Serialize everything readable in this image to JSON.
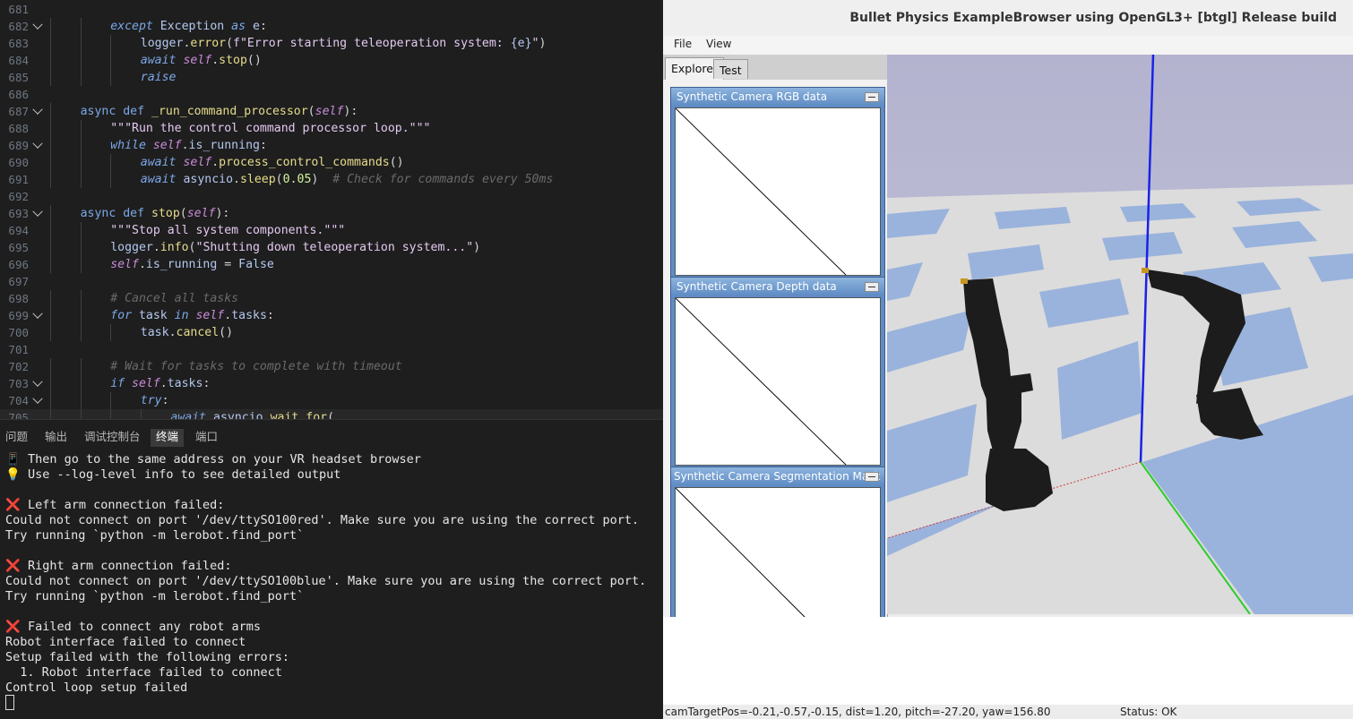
{
  "editor": {
    "lines": [
      {
        "num": "681",
        "indent": 0,
        "fold": false,
        "tokens": []
      },
      {
        "num": "682",
        "indent": 2,
        "fold": true,
        "tokens": [
          [
            "except ",
            "t-ctl"
          ],
          [
            "Exception ",
            "t-id"
          ],
          [
            "as ",
            "t-ctl"
          ],
          [
            "e",
            "t-id"
          ],
          [
            ":",
            "t-op"
          ]
        ]
      },
      {
        "num": "683",
        "indent": 3,
        "fold": false,
        "tokens": [
          [
            "logger",
            "t-id"
          ],
          [
            ".",
            "t-op"
          ],
          [
            "error",
            "t-fn"
          ],
          [
            "(",
            "t-op"
          ],
          [
            "f\"Error starting teleoperation system: ",
            "t-str"
          ],
          [
            "{e}",
            "t-id"
          ],
          [
            "\"",
            "t-str"
          ],
          [
            ")",
            "t-op"
          ]
        ]
      },
      {
        "num": "684",
        "indent": 3,
        "fold": false,
        "tokens": [
          [
            "await ",
            "t-ctl"
          ],
          [
            "self",
            "t-self"
          ],
          [
            ".",
            "t-op"
          ],
          [
            "stop",
            "t-fn"
          ],
          [
            "()",
            "t-op"
          ]
        ]
      },
      {
        "num": "685",
        "indent": 3,
        "fold": false,
        "tokens": [
          [
            "raise",
            "t-ctl"
          ]
        ]
      },
      {
        "num": "686",
        "indent": 0,
        "fold": false,
        "tokens": []
      },
      {
        "num": "687",
        "indent": 1,
        "fold": true,
        "tokens": [
          [
            "async ",
            "t-kw"
          ],
          [
            "def ",
            "t-kw"
          ],
          [
            "_run_command_processor",
            "t-fn"
          ],
          [
            "(",
            "t-op"
          ],
          [
            "self",
            "t-self"
          ],
          [
            "):",
            "t-op"
          ]
        ]
      },
      {
        "num": "688",
        "indent": 2,
        "fold": false,
        "tokens": [
          [
            "\"\"\"Run the control command processor loop.\"\"\"",
            "t-str"
          ]
        ]
      },
      {
        "num": "689",
        "indent": 2,
        "fold": true,
        "tokens": [
          [
            "while ",
            "t-ctl"
          ],
          [
            "self",
            "t-self"
          ],
          [
            ".",
            "t-op"
          ],
          [
            "is_running",
            "t-id"
          ],
          [
            ":",
            "t-op"
          ]
        ]
      },
      {
        "num": "690",
        "indent": 3,
        "fold": false,
        "tokens": [
          [
            "await ",
            "t-ctl"
          ],
          [
            "self",
            "t-self"
          ],
          [
            ".",
            "t-op"
          ],
          [
            "process_control_commands",
            "t-fn"
          ],
          [
            "()",
            "t-op"
          ]
        ]
      },
      {
        "num": "691",
        "indent": 3,
        "fold": false,
        "tokens": [
          [
            "await ",
            "t-ctl"
          ],
          [
            "asyncio",
            "t-id"
          ],
          [
            ".",
            "t-op"
          ],
          [
            "sleep",
            "t-fn"
          ],
          [
            "(",
            "t-op"
          ],
          [
            "0.05",
            "t-num"
          ],
          [
            ")  ",
            "t-op"
          ],
          [
            "# Check for commands every 50ms",
            "t-cm"
          ]
        ]
      },
      {
        "num": "692",
        "indent": 0,
        "fold": false,
        "tokens": []
      },
      {
        "num": "693",
        "indent": 1,
        "fold": true,
        "tokens": [
          [
            "async ",
            "t-kw"
          ],
          [
            "def ",
            "t-kw"
          ],
          [
            "stop",
            "t-fn"
          ],
          [
            "(",
            "t-op"
          ],
          [
            "self",
            "t-self"
          ],
          [
            "):",
            "t-op"
          ]
        ]
      },
      {
        "num": "694",
        "indent": 2,
        "fold": false,
        "tokens": [
          [
            "\"\"\"Stop all system components.\"\"\"",
            "t-str"
          ]
        ]
      },
      {
        "num": "695",
        "indent": 2,
        "fold": false,
        "tokens": [
          [
            "logger",
            "t-id"
          ],
          [
            ".",
            "t-op"
          ],
          [
            "info",
            "t-fn"
          ],
          [
            "(",
            "t-op"
          ],
          [
            "\"Shutting down teleoperation system...\"",
            "t-str"
          ],
          [
            ")",
            "t-op"
          ]
        ]
      },
      {
        "num": "696",
        "indent": 2,
        "fold": false,
        "tokens": [
          [
            "self",
            "t-self"
          ],
          [
            ".",
            "t-op"
          ],
          [
            "is_running ",
            "t-id"
          ],
          [
            "= ",
            "t-op"
          ],
          [
            "False",
            "t-id"
          ]
        ]
      },
      {
        "num": "697",
        "indent": 0,
        "fold": false,
        "tokens": []
      },
      {
        "num": "698",
        "indent": 2,
        "fold": false,
        "tokens": [
          [
            "# Cancel all tasks",
            "t-cm"
          ]
        ]
      },
      {
        "num": "699",
        "indent": 2,
        "fold": true,
        "tokens": [
          [
            "for ",
            "t-ctl"
          ],
          [
            "task ",
            "t-id"
          ],
          [
            "in ",
            "t-ctl"
          ],
          [
            "self",
            "t-self"
          ],
          [
            ".",
            "t-op"
          ],
          [
            "tasks",
            "t-id"
          ],
          [
            ":",
            "t-op"
          ]
        ]
      },
      {
        "num": "700",
        "indent": 3,
        "fold": false,
        "tokens": [
          [
            "task",
            "t-id"
          ],
          [
            ".",
            "t-op"
          ],
          [
            "cancel",
            "t-fn"
          ],
          [
            "()",
            "t-op"
          ]
        ]
      },
      {
        "num": "701",
        "indent": 0,
        "fold": false,
        "tokens": []
      },
      {
        "num": "702",
        "indent": 2,
        "fold": false,
        "tokens": [
          [
            "# Wait for tasks to complete with timeout",
            "t-cm"
          ]
        ]
      },
      {
        "num": "703",
        "indent": 2,
        "fold": true,
        "tokens": [
          [
            "if ",
            "t-ctl"
          ],
          [
            "self",
            "t-self"
          ],
          [
            ".",
            "t-op"
          ],
          [
            "tasks",
            "t-id"
          ],
          [
            ":",
            "t-op"
          ]
        ]
      },
      {
        "num": "704",
        "indent": 3,
        "fold": true,
        "tokens": [
          [
            "try",
            "t-ctl"
          ],
          [
            ":",
            "t-op"
          ]
        ]
      },
      {
        "num": "705",
        "indent": 4,
        "fold": false,
        "tokens": [
          [
            "await ",
            "t-ctl"
          ],
          [
            "asyncio",
            "t-id"
          ],
          [
            ".",
            "t-op"
          ],
          [
            "wait_for",
            "t-fn"
          ],
          [
            "(",
            "t-op"
          ]
        ]
      }
    ]
  },
  "panel": {
    "tabs": [
      "问题",
      "输出",
      "调试控制台",
      "终端",
      "端口"
    ],
    "active_tab": "终端"
  },
  "terminal": {
    "lines": [
      {
        "icon": "📱",
        "text": " Then go to the same address on your VR headset browser"
      },
      {
        "icon": "💡",
        "text": " Use --log-level info to see detailed output"
      },
      {
        "icon": "",
        "text": ""
      },
      {
        "icon": "❌",
        "text": " Left arm connection failed:"
      },
      {
        "icon": "",
        "text": "Could not connect on port '/dev/ttySO100red'. Make sure you are using the correct port."
      },
      {
        "icon": "",
        "text": "Try running `python -m lerobot.find_port`"
      },
      {
        "icon": "",
        "text": ""
      },
      {
        "icon": "❌",
        "text": " Right arm connection failed:"
      },
      {
        "icon": "",
        "text": "Could not connect on port '/dev/ttySO100blue'. Make sure you are using the correct port."
      },
      {
        "icon": "",
        "text": "Try running `python -m lerobot.find_port`"
      },
      {
        "icon": "",
        "text": ""
      },
      {
        "icon": "❌",
        "text": " Failed to connect any robot arms"
      },
      {
        "icon": "",
        "text": "Robot interface failed to connect"
      },
      {
        "icon": "",
        "text": "Setup failed with the following errors:"
      },
      {
        "icon": "",
        "text": "  1. Robot interface failed to connect"
      },
      {
        "icon": "",
        "text": "Control loop setup failed"
      }
    ]
  },
  "bullet": {
    "title": "Bullet Physics ExampleBrowser using OpenGL3+ [btgl] Release build",
    "menu": [
      "File",
      "View"
    ],
    "explorer_tabs": [
      "Explorer",
      "Test"
    ],
    "camera_panels": [
      "Synthetic Camera RGB data",
      "Synthetic Camera Depth data",
      "Synthetic Camera Segmentation Mask"
    ],
    "status_left": "camTargetPos=-0.21,-0.57,-0.15, dist=1.20, pitch=-27.20, yaw=156.80",
    "status_right": "Status: OK"
  }
}
